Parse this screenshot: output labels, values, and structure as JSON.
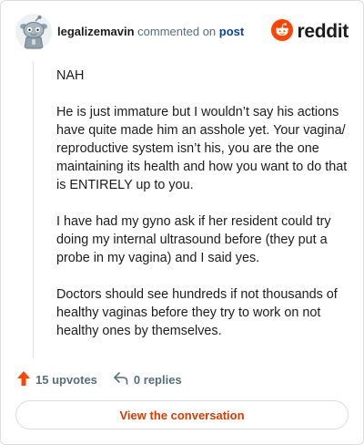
{
  "header": {
    "author": "legalizemavin",
    "action_text": "commented on",
    "post_link": "post",
    "brand": "reddit"
  },
  "comment": {
    "paragraphs": [
      "NAH",
      "He is just immature but I wouldn’t say his actions have quite made him an asshole yet. Your vagina/ reproductive system isn’t his, you are the one maintaining its health and how you want to do that is ENTIRELY up to you.",
      "I have had my gyno ask if her resident could try doing my internal ultrasound before (they put a probe in my vagina) and I said yes.",
      "Doctors should see hundreds if not thousands of healthy vaginas before they try to work on not healthy ones by themselves."
    ]
  },
  "actions": {
    "upvotes": "15 upvotes",
    "replies": "0 replies"
  },
  "cta": {
    "label": "View the conversation"
  },
  "colors": {
    "brand_orange": "#ff4500",
    "link_blue": "#0a449b",
    "cta_text": "#d93a00"
  },
  "icons": [
    "snoo-avatar-icon",
    "reddit-logo-icon",
    "upvote-arrow-icon",
    "reply-icon"
  ]
}
